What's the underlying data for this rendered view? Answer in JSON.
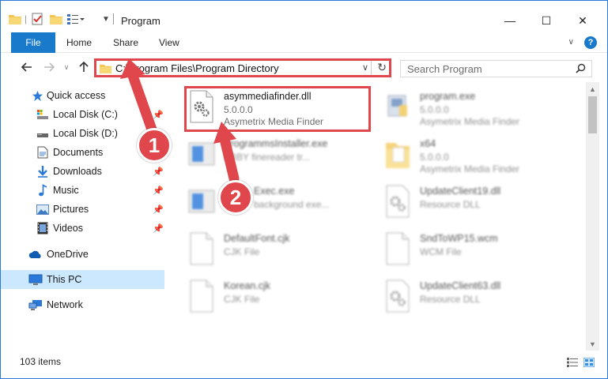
{
  "window": {
    "title": "Program",
    "controls": {
      "minimize": "—",
      "maximize": "☐",
      "close": "✕"
    }
  },
  "ribbon": {
    "tabs": [
      "File",
      "Home",
      "Share",
      "View"
    ],
    "help": "?"
  },
  "nav": {
    "address": "C:\\Program Files\\Program Directory",
    "search_placeholder": "Search Program"
  },
  "sidebar": {
    "items": [
      {
        "label": "Quick access",
        "icon": "star-icon",
        "pinned": false,
        "selected": false
      },
      {
        "label": "Local Disk (C:)",
        "icon": "drive-icon",
        "pinned": true,
        "selected": false
      },
      {
        "label": "Local Disk (D:)",
        "icon": "drive-icon",
        "pinned": false,
        "selected": false
      },
      {
        "label": "Documents",
        "icon": "documents-icon",
        "pinned": true,
        "selected": false
      },
      {
        "label": "Downloads",
        "icon": "download-icon",
        "pinned": true,
        "selected": false
      },
      {
        "label": "Music",
        "icon": "music-icon",
        "pinned": true,
        "selected": false
      },
      {
        "label": "Pictures",
        "icon": "pictures-icon",
        "pinned": true,
        "selected": false
      },
      {
        "label": "Videos",
        "icon": "videos-icon",
        "pinned": true,
        "selected": false
      },
      {
        "label": "OneDrive",
        "icon": "cloud-icon",
        "pinned": false,
        "selected": false
      },
      {
        "label": "This PC",
        "icon": "computer-icon",
        "pinned": false,
        "selected": true
      },
      {
        "label": "Network",
        "icon": "network-icon",
        "pinned": false,
        "selected": false
      }
    ]
  },
  "files": [
    {
      "name": "asymmediafinder.dll",
      "line1": "5.0.0.0",
      "line2": "Asymetrix Media Finder",
      "icon": "dll-gear-icon",
      "highlighted": true
    },
    {
      "name": "program.exe",
      "line1": "5.0.0.0",
      "line2": "Asymetrix Media Finder",
      "icon": "exe-icon",
      "highlighted": false
    },
    {
      "name": "ProgrammsInstaller.exe",
      "line1": "ABBY finereader tr...",
      "line2": "",
      "icon": "installer-icon",
      "highlighted": false
    },
    {
      "name": "x64",
      "line1": "5.0.0.0",
      "line2": "Asymetrix Media Finder",
      "icon": "folder-icon",
      "highlighted": false
    },
    {
      "name": "Exec.exe",
      "line1": "background exe...",
      "line2": "",
      "icon": "installer-icon",
      "highlighted": false
    },
    {
      "name": "UpdateClient19.dll",
      "line1": "Resource DLL",
      "line2": "",
      "icon": "dll-gear-icon",
      "highlighted": false
    },
    {
      "name": "DefaultFont.cjk",
      "line1": "CJK File",
      "line2": "",
      "icon": "blank-file-icon",
      "highlighted": false
    },
    {
      "name": "SndToWP15.wcm",
      "line1": "WCM File",
      "line2": "",
      "icon": "blank-file-icon",
      "highlighted": false
    },
    {
      "name": "Korean.cjk",
      "line1": "CJK File",
      "line2": "",
      "icon": "blank-file-icon",
      "highlighted": false
    },
    {
      "name": "UpdateClient63.dll",
      "line1": "Resource DLL",
      "line2": "",
      "icon": "dll-gear-icon",
      "highlighted": false
    }
  ],
  "status": {
    "count": "103 items"
  },
  "annotations": [
    {
      "label": "1"
    },
    {
      "label": "2"
    }
  ],
  "colors": {
    "accent": "#1979ca",
    "annotation": "#e0474c",
    "selected": "#cce8ff"
  }
}
